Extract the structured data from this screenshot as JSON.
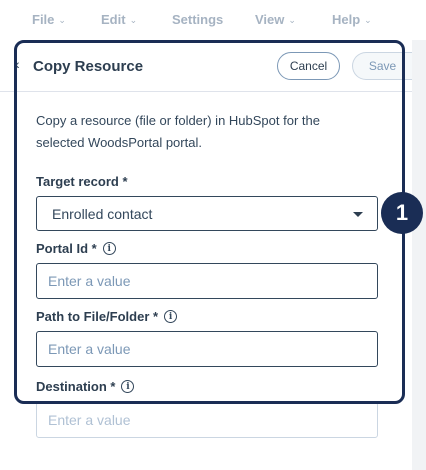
{
  "menu": {
    "items": [
      {
        "label": "File"
      },
      {
        "label": "Edit"
      },
      {
        "label": "Settings"
      },
      {
        "label": "View"
      },
      {
        "label": "Help"
      }
    ]
  },
  "panel": {
    "title": "Copy Resource",
    "cancel_label": "Cancel",
    "save_label": "Save",
    "description": "Copy a resource (file or folder) in HubSpot for the selected WoodsPortal portal."
  },
  "fields": {
    "target_record": {
      "label": "Target record *",
      "value": "Enrolled contact"
    },
    "portal_id": {
      "label": "Portal Id *",
      "placeholder": "Enter a value"
    },
    "path": {
      "label": "Path to File/Folder *",
      "placeholder": "Enter a value"
    },
    "destination": {
      "label": "Destination *",
      "placeholder": "Enter a value"
    }
  },
  "callout": {
    "number": "1"
  },
  "icons": {
    "info": "info-icon",
    "chevron": "chevron-down-icon",
    "back": "chevron-left-icon"
  }
}
